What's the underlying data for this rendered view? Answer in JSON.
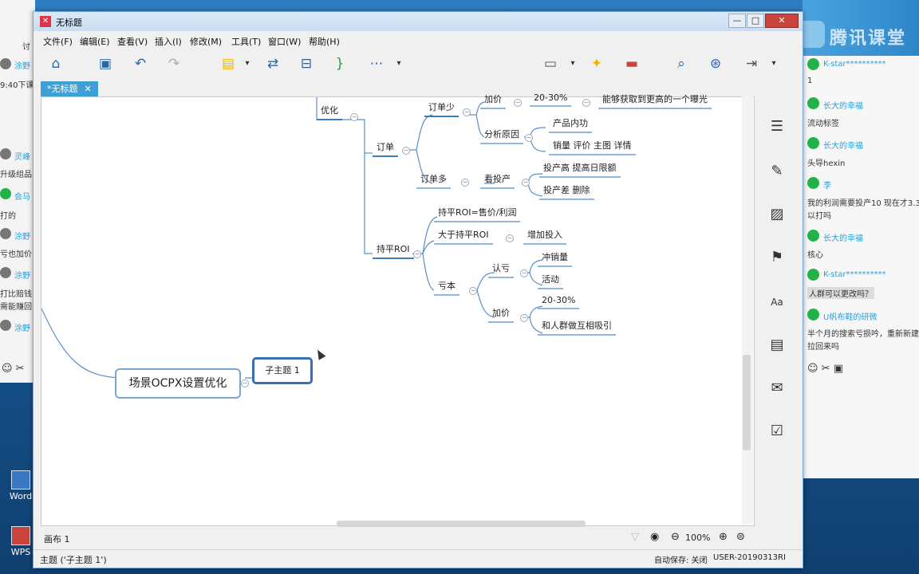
{
  "window": {
    "title": "无标题",
    "controls": {
      "minimize": "—",
      "maximize": "□",
      "close": "✕"
    }
  },
  "menu": [
    "文件(F)",
    "编辑(E)",
    "查看(V)",
    "插入(I)",
    "修改(M)",
    "工具(T)",
    "窗口(W)",
    "帮助(H)"
  ],
  "tab": {
    "label": "*无标题",
    "close": "✕"
  },
  "mindmap": {
    "root": "场景OCPX设置优化",
    "subtopic": "子主题 1",
    "nodes": {
      "youhua": "优化",
      "dingdan": "订单",
      "dingdanshao": "订单少",
      "jiajia": "加价",
      "pct1": "20-30%",
      "jiajia_note": "能够获取到更高的一个曝光",
      "fenxi": "分析原因",
      "chanpin": "产品内功",
      "xiaoliang": "销量 评价 主图 详情",
      "dingdanduo": "订单多",
      "kantouchan": "看投产",
      "touchangao": "投产高 提高日限额",
      "touchancha": "投产差 删除",
      "chiping": "持平ROI",
      "chiping_formula": "持平ROI=售价/利润",
      "dayu": "大于持平ROI",
      "zengjia": "增加投入",
      "kuiben": "亏本",
      "renkui": "认亏",
      "chongxiao": "冲销量",
      "huodong": "活动",
      "jiajia2": "加价",
      "pct2": "20-30%",
      "hurenqun": "和人群做互相吸引"
    }
  },
  "canvas_tab": "画布 1",
  "zoom": "100%",
  "status": {
    "left": "主题 ('子主题 1')",
    "autosave": "自动保存: 关闭",
    "user": "USER-20190313RI"
  },
  "right_chat": {
    "brand": "腾讯课堂",
    "messages": [
      {
        "name": "K-star**********",
        "text": "1"
      },
      {
        "name": "长大的幸福",
        "text": "流动标签"
      },
      {
        "name": "长大的幸福",
        "text": "头导hexin"
      },
      {
        "name": "李",
        "text": "我的利润需要投产10  现在才3.3"
      },
      {
        "name": "",
        "text": "以打吗"
      },
      {
        "name": "长大的幸福",
        "text": "核心"
      },
      {
        "name": "K-star**********",
        "text": "人群可以更改吗？"
      },
      {
        "name": "U帆布鞋的研微",
        "text": "半个月的搜索亏损吟，重新新建"
      },
      {
        "name": "",
        "text": "拉回来吗"
      }
    ]
  },
  "left_chat": {
    "lines": [
      "讨",
      "涂野",
      "9:40下课",
      "灵峰",
      "升级组品",
      "会马",
      "打的",
      "涂野",
      "亏也加价",
      "涂野",
      "打比赔钱",
      "需能赚回",
      "涂野"
    ]
  },
  "desktop_icons": [
    "Word",
    "WPS"
  ]
}
